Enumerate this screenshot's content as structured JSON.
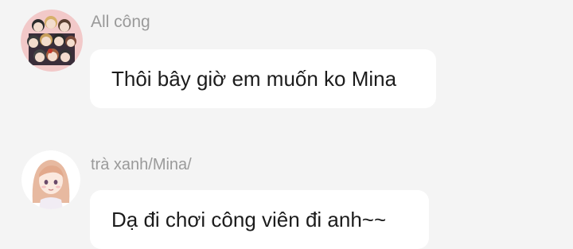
{
  "messages": [
    {
      "sender": "All công",
      "text": "Thôi bây giờ em muốn ko Mina",
      "avatar_icon": "group-chibi-avatar-icon"
    },
    {
      "sender": "trà xanh/Mina/",
      "text": "Dạ đi chơi công viên đi anh~~",
      "avatar_icon": "girl-avatar-icon"
    }
  ],
  "colors": {
    "background": "#f4f4f4",
    "bubble": "#ffffff",
    "sender_text": "#9a9a9a",
    "message_text": "#1c1c1c"
  }
}
